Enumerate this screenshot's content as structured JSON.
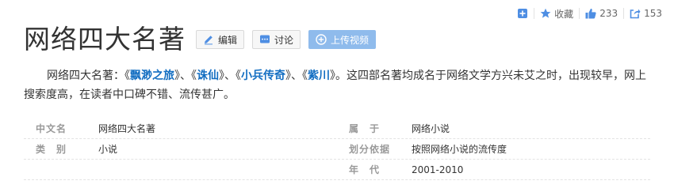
{
  "top_actions": {
    "collect_label": "收藏",
    "like_count": "233",
    "share_count": "153"
  },
  "title": "网络四大名著",
  "buttons": {
    "edit": "编辑",
    "discuss": "讨论",
    "upload_video": "上传视频"
  },
  "summary": {
    "prefix": "网络四大名著：",
    "works": [
      "飘渺之旅",
      "诛仙",
      "小兵传奇",
      "紫川"
    ],
    "open_bracket": "《",
    "close_bracket": "》",
    "separator": "、",
    "suffix": "。这四部名著均成名于网络文学方兴未艾之时，出现较早，网上搜索度高，在读者中口碑不错、流传甚广。"
  },
  "info": {
    "rows": [
      {
        "left_name": "中文名",
        "left_value": "网络四大名著",
        "right_name": "属　于",
        "right_value": "网络小说"
      },
      {
        "left_name": "类　别",
        "left_value": "小说",
        "right_name": "划分依据",
        "right_value": "按照网络小说的流传度"
      },
      {
        "left_name": "",
        "left_value": "",
        "right_name": "年　代",
        "right_value": "2001-2010"
      }
    ]
  },
  "colors": {
    "link": "#136ec2",
    "primary_button": "#8fbbec",
    "icon_blue": "#4e8ee3"
  }
}
